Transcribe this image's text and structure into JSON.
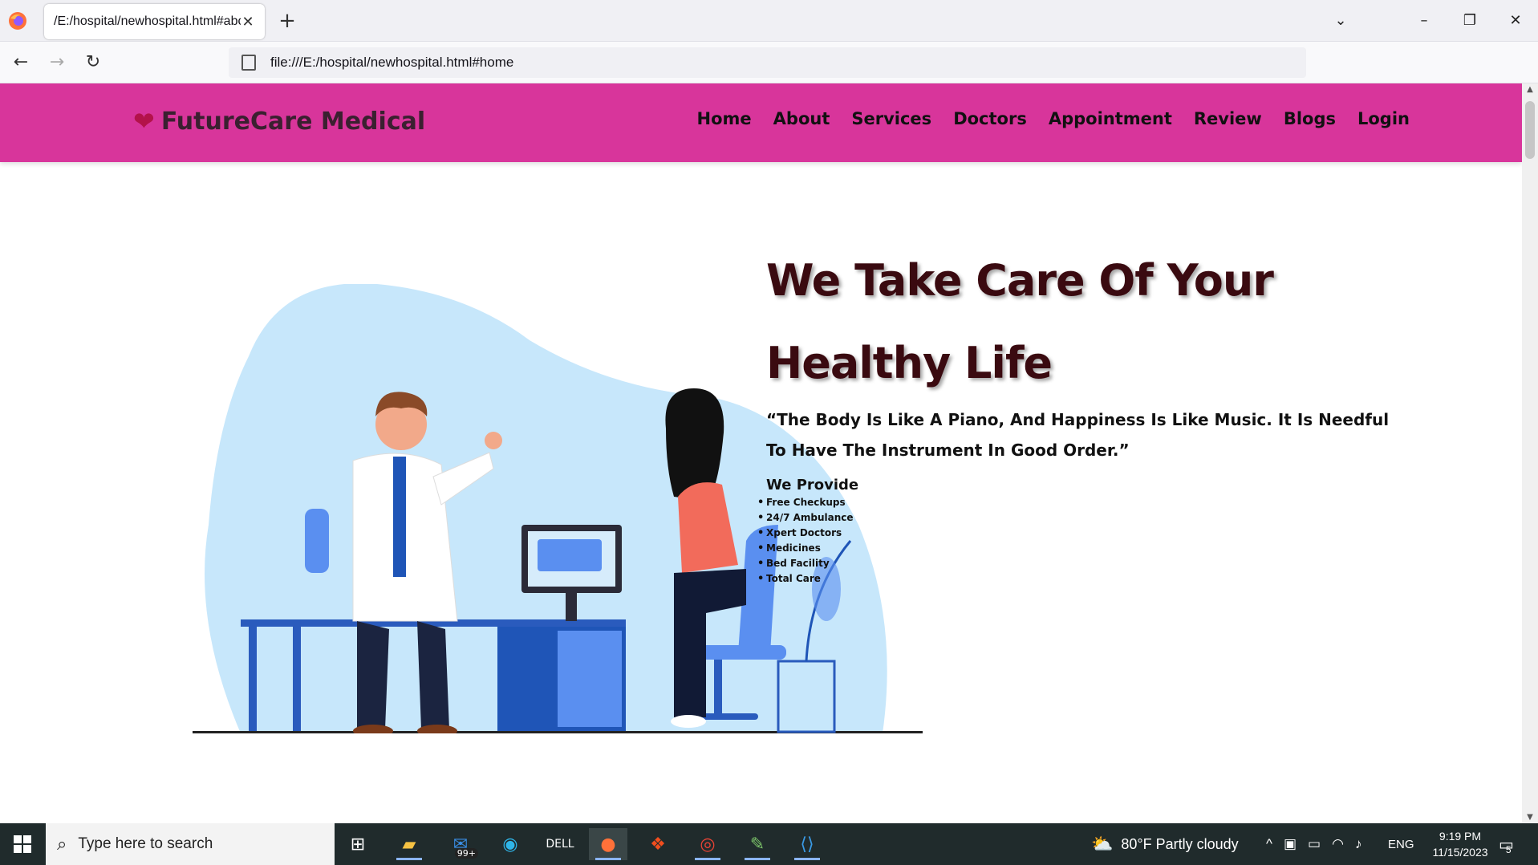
{
  "browser": {
    "tab_title": "/E:/hospital/newhospital.html#about",
    "url": "file:///E:/hospital/newhospital.html#home"
  },
  "site": {
    "brand": "FutureCare Medical",
    "nav": [
      "Home",
      "About",
      "Services",
      "Doctors",
      "Appointment",
      "Review",
      "Blogs",
      "Login"
    ],
    "headline_line1": "We Take Care Of Your",
    "headline_line2": "Healthy Life",
    "quote": "“The Body Is Like A Piano, And Happiness Is Like Music. It Is Needful To Have The Instrument In Good Order.”",
    "provide_heading": "We Provide",
    "provide_items": [
      "Free Checkups",
      "24/7 Ambulance",
      "Xpert Doctors",
      "Medicines",
      "Bed Facility",
      "Total Care"
    ]
  },
  "taskbar": {
    "search_placeholder": "Type here to search",
    "mail_badge": "99+",
    "weather": "80°F  Partly cloudy",
    "language": "ENG",
    "time": "9:19 PM",
    "date": "11/15/2023",
    "notifications": "5"
  },
  "colors": {
    "header_bg": "#d8359b",
    "headline": "#3a0a10",
    "blob": "#c7e7fb"
  }
}
